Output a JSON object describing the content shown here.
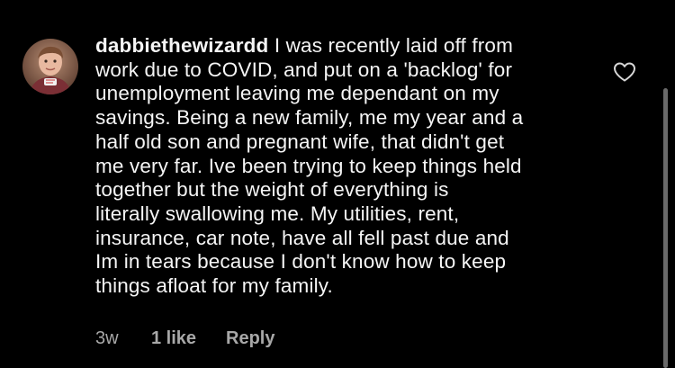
{
  "comment": {
    "username": "dabbiethewizardd",
    "lines": [
      "I was recently laid off from",
      "work due to COVID, and put on a 'backlog' for",
      "unemployment leaving me dependant on my",
      "savings. Being a new family, me my year and a",
      "half old son and pregnant wife, that didn't get",
      "me very far. Ive been trying to keep things held",
      "together but the weight of everything is",
      "literally swallowing me. My utilities, rent,",
      "insurance, car note, have all fell past due and",
      "Im in tears because I don't know how to keep",
      "things afloat for my family."
    ],
    "time": "3w",
    "likes": "1 like",
    "reply_label": "Reply",
    "like_icon": "heart-outline-icon"
  },
  "colors": {
    "background": "#000000",
    "text": "#f5f5f5",
    "meta": "#a8a8a8",
    "scrollbar": "#6a6a6a"
  }
}
